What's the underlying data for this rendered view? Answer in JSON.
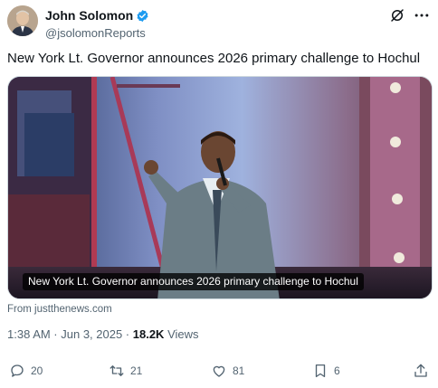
{
  "author": {
    "display_name": "John Solomon",
    "handle": "@jsolomonReports"
  },
  "tweet": {
    "text": "New York Lt. Governor announces 2026 primary challenge to Hochul",
    "media_caption": "New York Lt. Governor announces 2026 primary challenge to Hochul",
    "source": "From justthenews.com",
    "time": "1:38 AM · Jun 3, 2025 · ",
    "views_count": "18.2K",
    "views_label": " Views"
  },
  "actions": {
    "replies": "20",
    "reposts": "21",
    "likes": "81",
    "bookmarks": "6"
  },
  "colors": {
    "verified": "#1d9bf0",
    "secondary_text": "#536471",
    "primary_text": "#0f1419"
  },
  "icons": [
    "grok-icon",
    "more-icon",
    "verified-badge-icon",
    "reply-icon",
    "repost-icon",
    "like-icon",
    "bookmark-icon",
    "share-icon"
  ]
}
